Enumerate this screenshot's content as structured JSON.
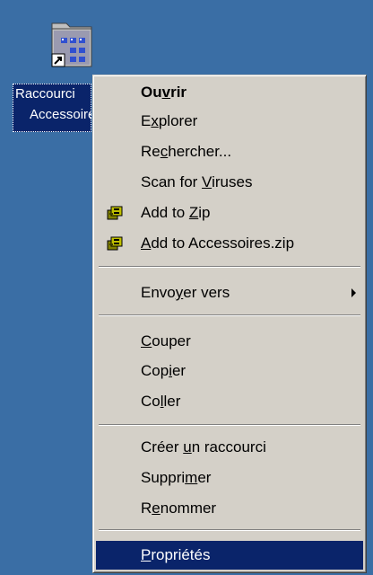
{
  "desktop": {
    "background": "#3a6ea5",
    "icon": {
      "name": "folder-shortcut-icon",
      "label_line1": "Raccourci",
      "label_line2": "Accessoires"
    }
  },
  "context_menu": {
    "items": [
      {
        "pre": "Ou",
        "key": "v",
        "post": "rir",
        "bold": true,
        "icon": null,
        "submenu": false,
        "selected": false
      },
      {
        "pre": "E",
        "key": "x",
        "post": "plorer",
        "bold": false,
        "icon": null,
        "submenu": false,
        "selected": false
      },
      {
        "pre": "Re",
        "key": "c",
        "post": "hercher...",
        "bold": false,
        "icon": null,
        "submenu": false,
        "selected": false
      },
      {
        "pre": "Scan for ",
        "key": "V",
        "post": "iruses",
        "bold": false,
        "icon": null,
        "submenu": false,
        "selected": false
      },
      {
        "pre": "Add to ",
        "key": "Z",
        "post": "ip",
        "bold": false,
        "icon": "winzip-icon",
        "submenu": false,
        "selected": false
      },
      {
        "pre": "",
        "key": "A",
        "post": "dd to Accessoires.zip",
        "bold": false,
        "icon": "winzip-icon",
        "submenu": false,
        "selected": false
      },
      {
        "pre": "Envo",
        "key": "y",
        "post": "er vers",
        "bold": false,
        "icon": null,
        "submenu": true,
        "selected": false
      },
      {
        "pre": "",
        "key": "C",
        "post": "ouper",
        "bold": false,
        "icon": null,
        "submenu": false,
        "selected": false
      },
      {
        "pre": "Cop",
        "key": "i",
        "post": "er",
        "bold": false,
        "icon": null,
        "submenu": false,
        "selected": false
      },
      {
        "pre": "Co",
        "key": "l",
        "post": "ler",
        "bold": false,
        "icon": null,
        "submenu": false,
        "selected": false
      },
      {
        "pre": "Créer ",
        "key": "u",
        "post": "n raccourci",
        "bold": false,
        "icon": null,
        "submenu": false,
        "selected": false
      },
      {
        "pre": "Suppri",
        "key": "m",
        "post": "er",
        "bold": false,
        "icon": null,
        "submenu": false,
        "selected": false
      },
      {
        "pre": "R",
        "key": "e",
        "post": "nommer",
        "bold": false,
        "icon": null,
        "submenu": false,
        "selected": false
      },
      {
        "pre": "",
        "key": "P",
        "post": "ropriétés",
        "bold": false,
        "icon": null,
        "submenu": false,
        "selected": true
      }
    ],
    "colors": {
      "face": "#d4d0c8",
      "highlight": "#0a246a",
      "highlight_text": "#ffffff"
    }
  }
}
